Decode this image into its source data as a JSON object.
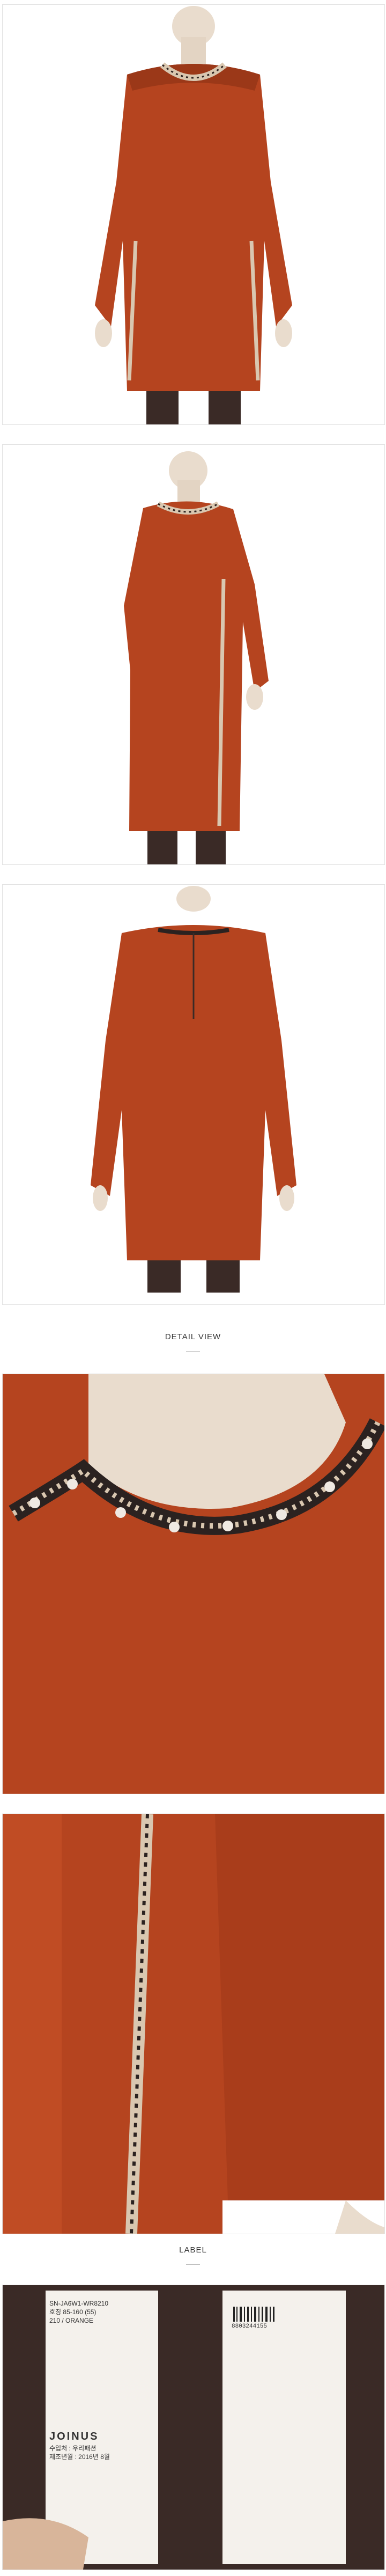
{
  "sections": {
    "detail_view": "DETAIL VIEW",
    "label": "LABEL"
  },
  "colors": {
    "garment": "#b5441f",
    "garment_dark": "#8a2f14",
    "trim": "#d9c7b0",
    "skin": "#e9dccd",
    "tights": "#3a2a26",
    "background": "#ffffff"
  },
  "photos": [
    {
      "name": "front-view",
      "description_icon": "dress-front-icon"
    },
    {
      "name": "side-view",
      "description_icon": "dress-side-icon"
    },
    {
      "name": "back-view",
      "description_icon": "dress-back-icon"
    },
    {
      "name": "neckline-detail",
      "description_icon": "neckline-closeup-icon"
    },
    {
      "name": "side-trim-detail",
      "description_icon": "trim-closeup-icon"
    },
    {
      "name": "care-labels",
      "description_icon": "label-closeup-icon"
    }
  ],
  "label_left": {
    "style_code": "SN-JA6W1-WR8210",
    "size_line": "호칭 85-160 (55)",
    "color_line": "210 / ORANGE",
    "brand": "JOINUS",
    "import_line": "수입처 : 우리패션",
    "date_line": "제조년월 : 2016년 8월"
  },
  "label_right": {
    "barcode_text": "8803244155"
  }
}
